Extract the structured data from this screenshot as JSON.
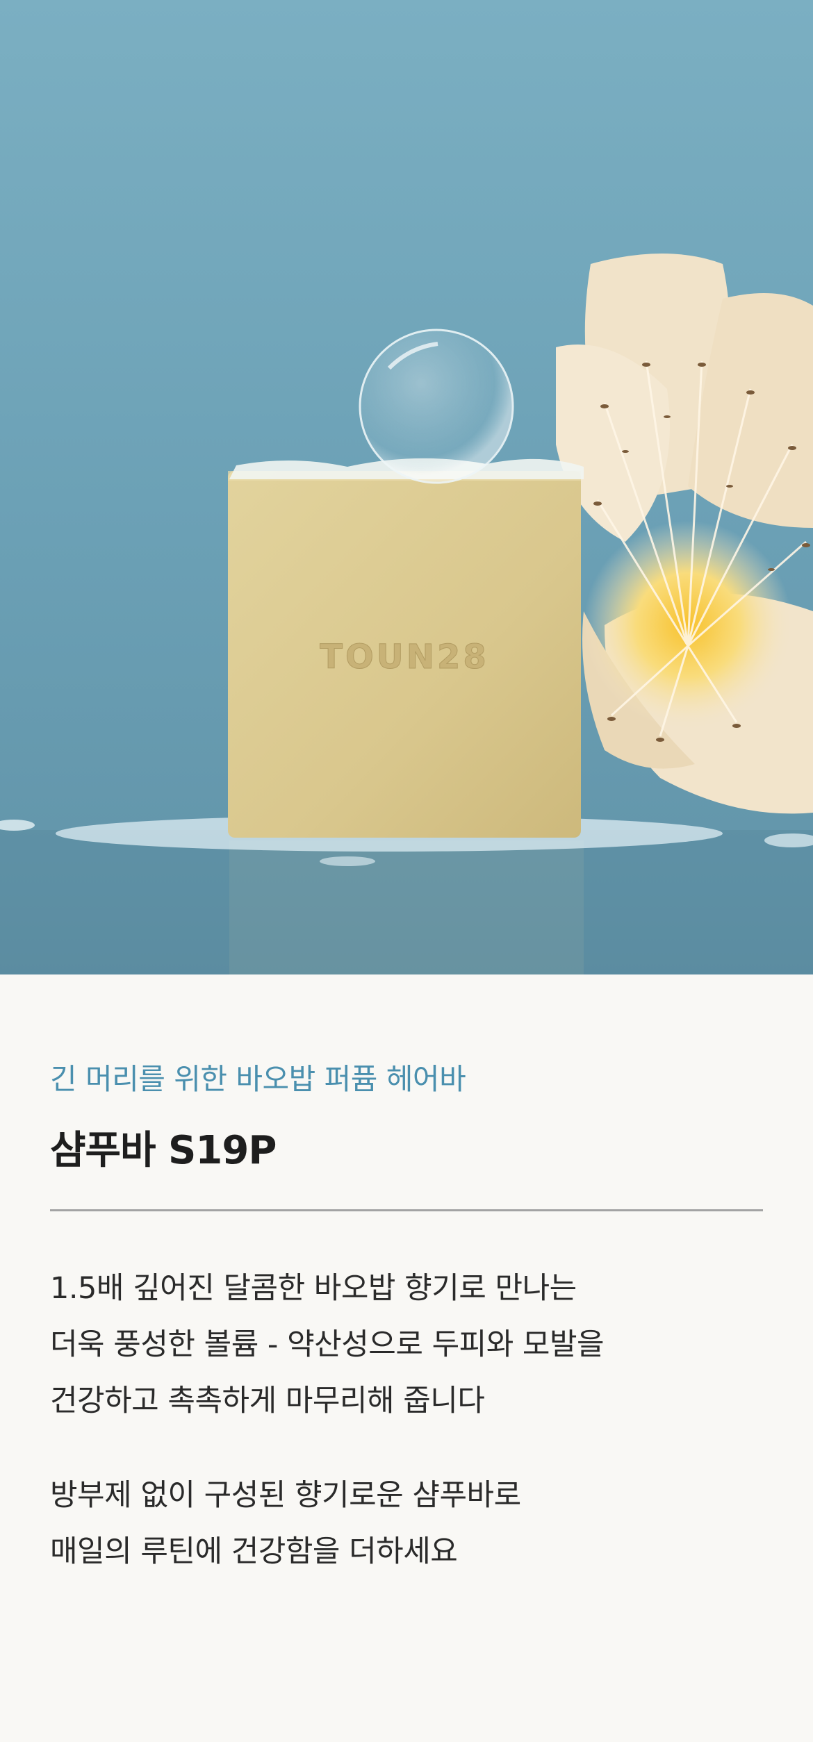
{
  "hero": {
    "image_alt": "Square yellow shampoo bar with foam bubble beside a cream flower on a blue background",
    "bar_embossed_text": "TOUN28",
    "colors": {
      "background": "#6ea3b7",
      "bar": "#dccb92",
      "flower": "#f3e5cc",
      "flower_center": "#f6c84a"
    }
  },
  "product": {
    "subtitle": "긴 머리를 위한 바오밥 퍼퓸 헤어바",
    "title": "샴푸바 S19P"
  },
  "description": {
    "paragraph1": [
      "1.5배 깊어진 달콤한 바오밥 향기로 만나는",
      "더욱 풍성한 볼륨 - 약산성으로 두피와 모발을",
      "건강하고 촉촉하게 마무리해 줍니다"
    ],
    "paragraph2": [
      "방부제 없이 구성된 향기로운 샴푸바로",
      "매일의 루틴에 건강함을 더하세요"
    ]
  },
  "colors": {
    "page_background": "#f9f8f5",
    "subtitle": "#4a8fae",
    "title": "#1e1e1e",
    "body_text": "#2a2a2a",
    "divider": "#a3a3a3"
  }
}
